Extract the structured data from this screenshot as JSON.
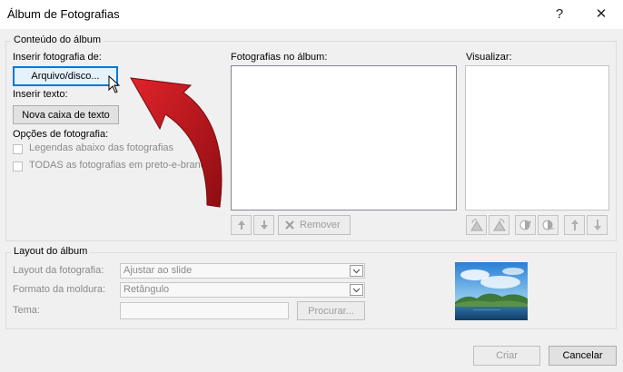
{
  "window": {
    "title": "Álbum de Fotografias",
    "help_label": "?",
    "close_label": "✕"
  },
  "content_group": {
    "legend": "Conteúdo do álbum",
    "insert_photo_label": "Inserir fotografia de:",
    "file_disk_button": "Arquivo/disco...",
    "insert_text_label": "Inserir texto:",
    "new_textbox_button": "Nova caixa de texto",
    "photo_options_label": "Opções de fotografia:",
    "captions_option": "Legendas abaixo das fotografias",
    "grayscale_option": "TODAS as fotografias em preto-e-branco",
    "photos_in_album_label": "Fotografias no álbum:",
    "preview_label": "Visualizar:",
    "remove_button": "Remover"
  },
  "layout_group": {
    "legend": "Layout do álbum",
    "picture_layout_label": "Layout da fotografia:",
    "picture_layout_value": "Ajustar ao slide",
    "frame_shape_label": "Formato da moldura:",
    "frame_shape_value": "Retângulo",
    "theme_label": "Tema:",
    "theme_value": "",
    "browse_button": "Procurar..."
  },
  "footer": {
    "create_button": "Criar",
    "cancel_button": "Cancelar"
  },
  "icons": {
    "move_up": "arrow-up-icon",
    "move_down": "arrow-down-icon",
    "remove": "x-icon",
    "rotate_left": "rotate-left-icon",
    "rotate_right": "rotate-right-icon",
    "contrast_more": "contrast-more-icon",
    "contrast_less": "contrast-less-icon",
    "brightness_more": "brightness-more-icon",
    "brightness_less": "brightness-less-icon"
  },
  "colors": {
    "focus_border": "#0078d7",
    "annotation_arrow": "#c0121b"
  }
}
